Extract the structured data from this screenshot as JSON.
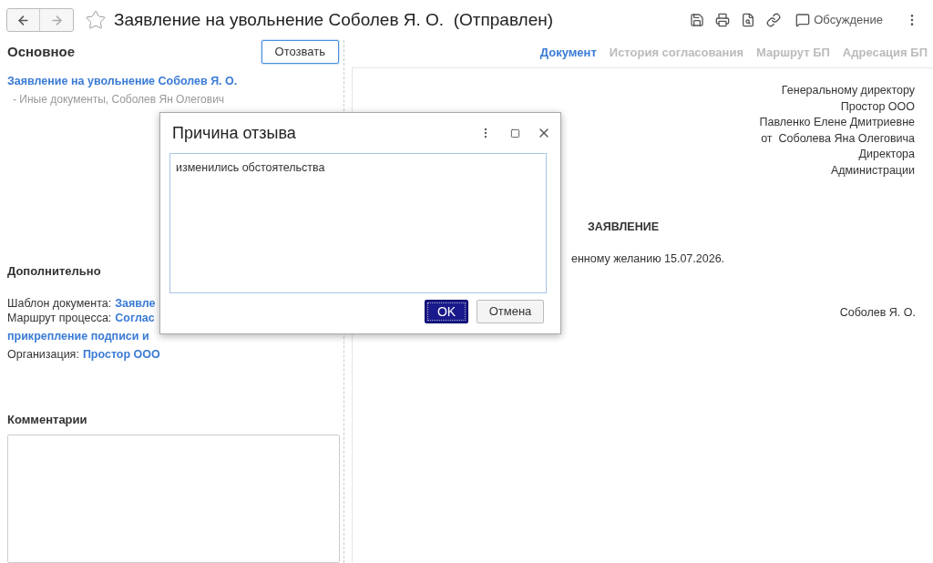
{
  "window": {
    "title": "Заявление на увольнение Соболев Я. О.  (Отправлен)",
    "favorite": false
  },
  "toolbar": {
    "discussion": "Обсуждение"
  },
  "main": {
    "heading": "Основное",
    "recall_button": "Отозвать",
    "document_link": "Заявление на увольнение Соболев Я. О.",
    "document_subtitle": "- Иные документы, Соболев Ян Олегович"
  },
  "additional": {
    "heading": "Дополнительно",
    "fields": [
      {
        "label": "Шаблон документа:",
        "value": "Заявле"
      },
      {
        "label": "Маршрут процесса:",
        "value": "Соглас"
      },
      {
        "value": "прикрепление подписи и"
      },
      {
        "label": "Организация:",
        "value": "Простор ООО"
      }
    ]
  },
  "comments": {
    "heading": "Комментарии"
  },
  "tabs": [
    {
      "label": "Документ",
      "selected": true
    },
    {
      "label": "История согласования",
      "selected": false
    },
    {
      "label": "Маршрут БП",
      "selected": false
    },
    {
      "label": "Адресация БП",
      "selected": false
    }
  ],
  "document": {
    "addressee": [
      "Генеральному директору",
      "Простор ООО",
      "Павленко Елене Дмитриевне",
      "от  Соболева Яна Олеговича",
      "Директора",
      "Администрации"
    ],
    "title": "ЗАЯВЛЕНИЕ",
    "body": "енному желанию 15.07.2026.",
    "signature": "Соболев Я. О."
  },
  "dialog": {
    "title": "Причина отзыва",
    "value": "изменились обстоятельства",
    "ok": "OK",
    "cancel": "Отмена"
  }
}
